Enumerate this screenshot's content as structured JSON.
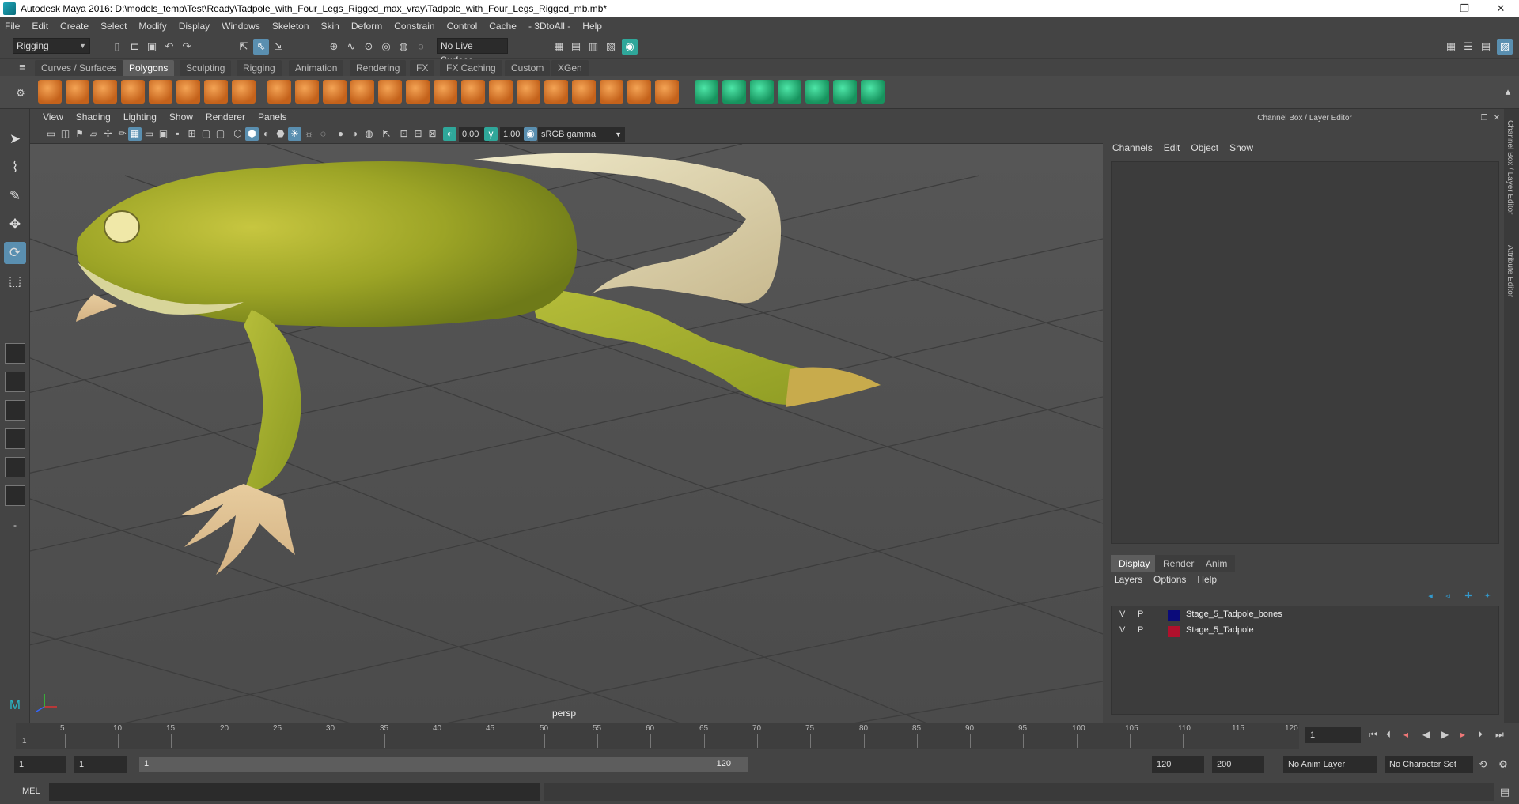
{
  "window": {
    "title": "Autodesk Maya 2016: D:\\models_temp\\Test\\Ready\\Tadpole_with_Four_Legs_Rigged_max_vray\\Tadpole_with_Four_Legs_Rigged_mb.mb*",
    "minimize": "—",
    "restore": "❐",
    "close": "✕"
  },
  "menubar": [
    "File",
    "Edit",
    "Create",
    "Select",
    "Modify",
    "Display",
    "Windows",
    "Skeleton",
    "Skin",
    "Deform",
    "Constrain",
    "Control",
    "Cache",
    "- 3DtoAll -",
    "Help"
  ],
  "statusline": {
    "menuset": "Rigging",
    "live_surface": "No Live Surface"
  },
  "shelf_tabs": [
    "Curves / Surfaces",
    "Polygons",
    "Sculpting",
    "Rigging",
    "Animation",
    "Rendering",
    "FX",
    "FX Caching",
    "Custom",
    "XGen"
  ],
  "active_shelf_tab": "Polygons",
  "viewport": {
    "menu": [
      "View",
      "Shading",
      "Lighting",
      "Show",
      "Renderer",
      "Panels"
    ],
    "exposure": "0.00",
    "gamma": "1.00",
    "color_space": "sRGB gamma",
    "camera_label": "persp"
  },
  "right_panel": {
    "header": "Channel Box / Layer Editor",
    "channel_menu": [
      "Channels",
      "Edit",
      "Object",
      "Show"
    ],
    "layer_tabs": [
      "Display",
      "Render",
      "Anim"
    ],
    "active_layer_tab": "Display",
    "layer_menu": [
      "Layers",
      "Options",
      "Help"
    ],
    "layers": [
      {
        "v": "V",
        "p": "P",
        "color": "#0b0b7a",
        "name": "Stage_5_Tadpole_bones"
      },
      {
        "v": "V",
        "p": "P",
        "color": "#b0102c",
        "name": "Stage_5_Tadpole"
      }
    ],
    "side_tabs": [
      "Channel Box / Layer Editor",
      "Attribute Editor"
    ]
  },
  "timeline": {
    "ticks": [
      "5",
      "10",
      "15",
      "20",
      "25",
      "30",
      "35",
      "40",
      "45",
      "50",
      "55",
      "60",
      "65",
      "70",
      "75",
      "80",
      "85",
      "90",
      "95",
      "100",
      "105",
      "110",
      "115",
      "120"
    ],
    "current_frame_marker": "1",
    "current_frame": "1"
  },
  "range": {
    "start": "1",
    "anim_start": "1",
    "slider_start": "1",
    "slider_end": "120",
    "anim_end": "120",
    "end": "200",
    "anim_layer": "No Anim Layer",
    "character_set": "No Character Set"
  },
  "cmdline": {
    "label": "MEL"
  },
  "colors": {
    "accent": "#5a8fb0",
    "panel_bg": "#444444",
    "viewport_bg": "#525252"
  }
}
